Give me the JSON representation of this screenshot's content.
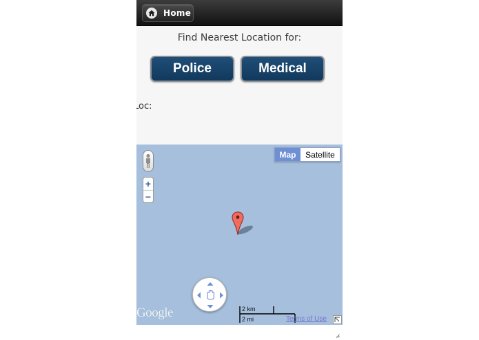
{
  "header": {
    "home_label": "Home",
    "home_icon": "home-icon"
  },
  "main": {
    "prompt": "Find Nearest Location for:",
    "police_label": "Police",
    "medical_label": "Medical",
    "loc_label": "Loc:"
  },
  "map": {
    "map_type_options": [
      "Map",
      "Satellite"
    ],
    "selected_map_type": "Map",
    "zoom_in": "+",
    "zoom_out": "−",
    "logo": "Google",
    "scale_km": "2 km",
    "scale_mi": "2 mi",
    "terms": "Terms of Use",
    "colors": {
      "water": "#a5bfdd",
      "button": "#1f4e78",
      "marker": "#f16b5e"
    }
  }
}
